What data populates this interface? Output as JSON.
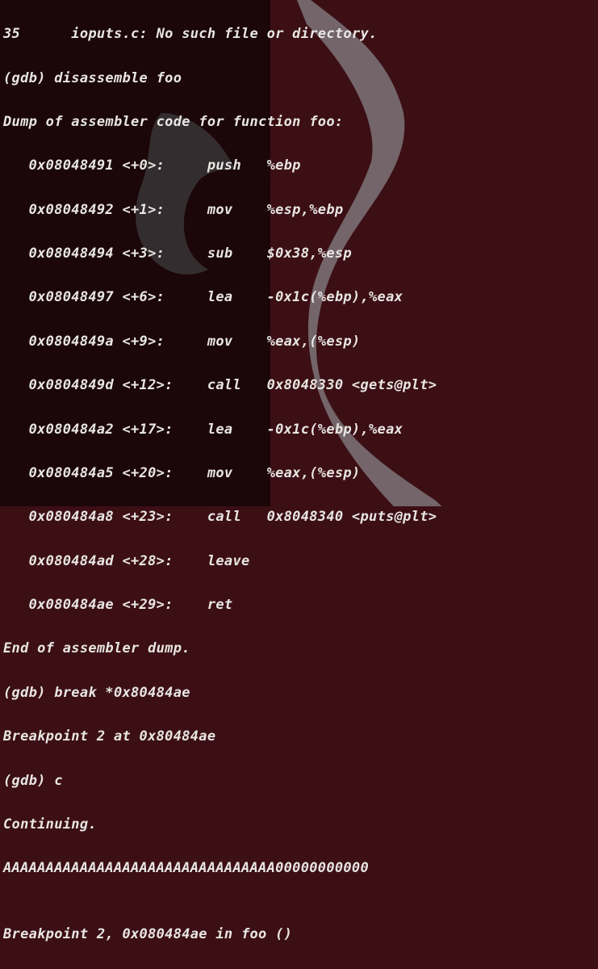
{
  "terminal": {
    "lines": [
      "35      ioputs.c: No such file or directory.",
      "(gdb) disassemble foo",
      "Dump of assembler code for function foo:",
      "   0x08048491 <+0>:     push   %ebp",
      "   0x08048492 <+1>:     mov    %esp,%ebp",
      "   0x08048494 <+3>:     sub    $0x38,%esp",
      "   0x08048497 <+6>:     lea    -0x1c(%ebp),%eax",
      "   0x0804849a <+9>:     mov    %eax,(%esp)",
      "   0x0804849d <+12>:    call   0x8048330 <gets@plt>",
      "   0x080484a2 <+17>:    lea    -0x1c(%ebp),%eax",
      "   0x080484a5 <+20>:    mov    %eax,(%esp)",
      "   0x080484a8 <+23>:    call   0x8048340 <puts@plt>",
      "   0x080484ad <+28>:    leave  ",
      "   0x080484ae <+29>:    ret    ",
      "End of assembler dump.",
      "(gdb) break *0x80484ae",
      "Breakpoint 2 at 0x80484ae",
      "(gdb) c",
      "Continuing.",
      "AAAAAAAAAAAAAAAAAAAAAAAAAAAAAAAA00000000000",
      "",
      "Breakpoint 2, 0x080484ae in foo ()"
    ]
  }
}
